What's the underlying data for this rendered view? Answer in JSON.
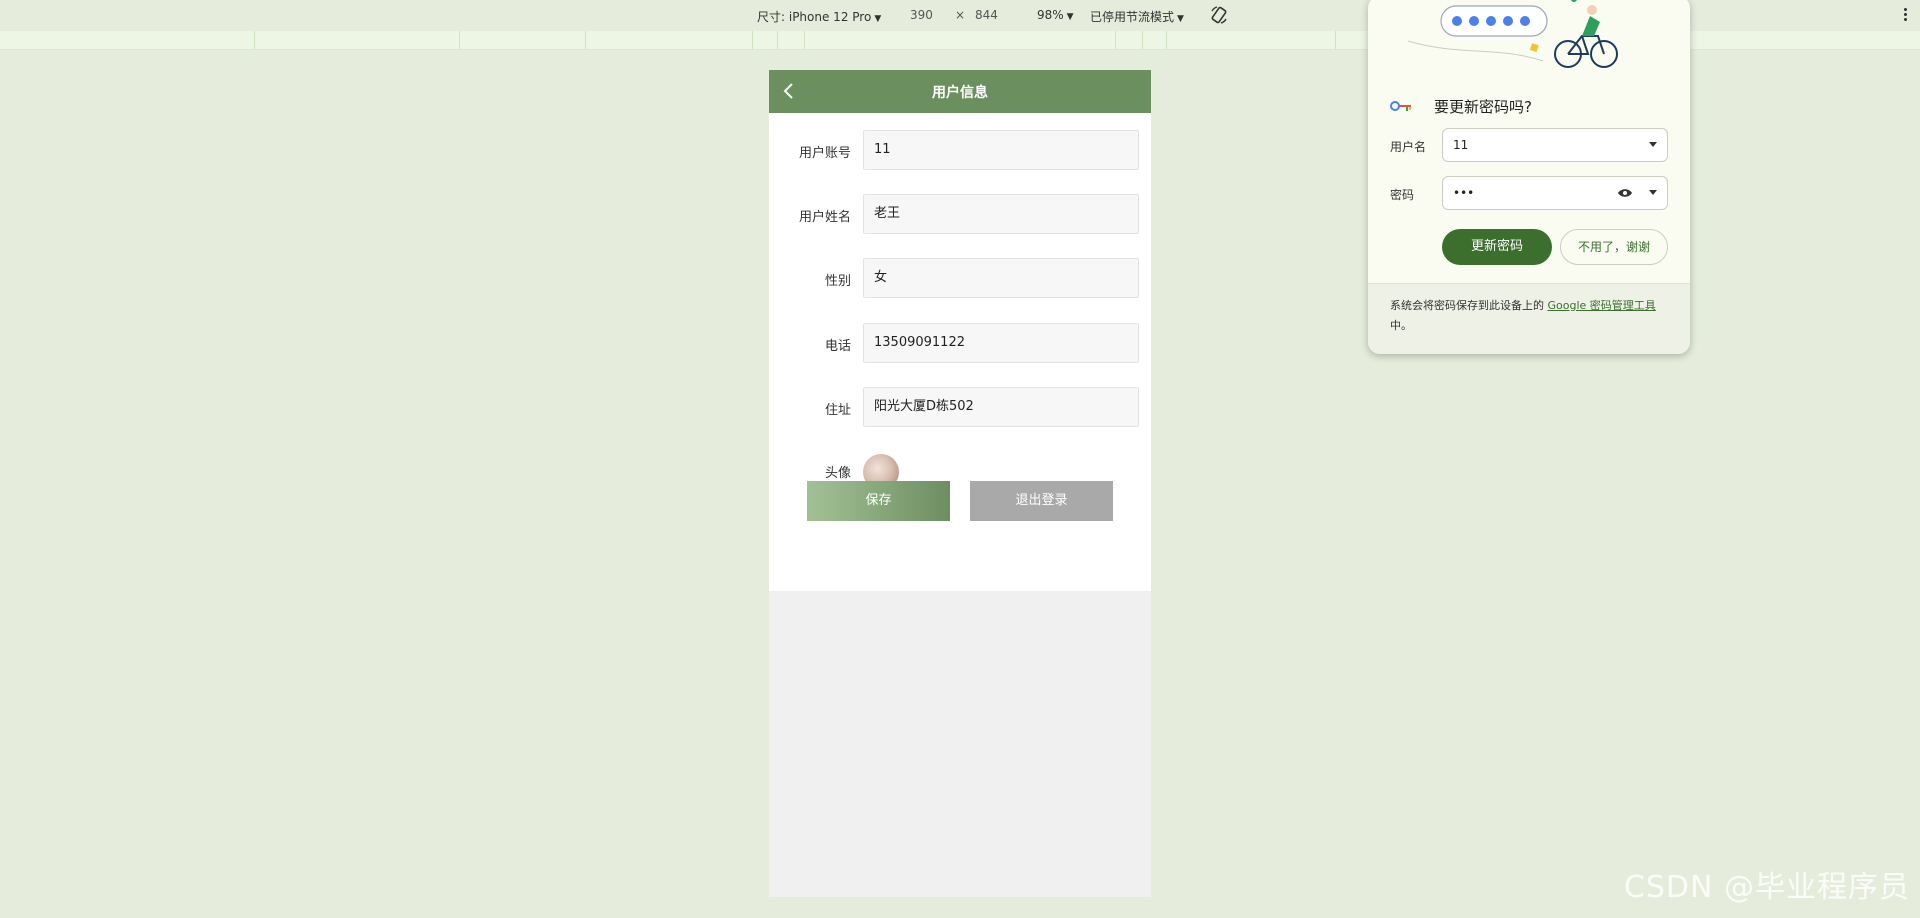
{
  "devtools": {
    "device_label": "尺寸: iPhone 12 Pro",
    "width": "390",
    "times": "×",
    "height": "844",
    "zoom": "98%",
    "throttle": "已停用节流模式"
  },
  "app": {
    "header_title": "用户信息",
    "fields": [
      {
        "label": "用户账号",
        "value": "11"
      },
      {
        "label": "用户姓名",
        "value": "老王"
      },
      {
        "label": "性别",
        "value": "女"
      },
      {
        "label": "电话",
        "value": "13509091122"
      },
      {
        "label": "住址",
        "value": "阳光大厦D栋502"
      }
    ],
    "avatar_label": "头像",
    "save_label": "保存",
    "logout_label": "退出登录"
  },
  "password_popup": {
    "title": "要更新密码吗?",
    "username_label": "用户名",
    "username_value": "11",
    "password_label": "密码",
    "password_value": "•••",
    "update_button": "更新密码",
    "no_thanks_button": "不用了，谢谢",
    "footer_text": "系统会将密码保存到此设备上的",
    "footer_link": "Google 密码管理工具",
    "footer_suffix": "中。"
  },
  "watermark": "CSDN @毕业程序员",
  "colors": {
    "page_bg": "#e5ecdb",
    "header_green": "#6b8f5f",
    "update_green": "#3c6e2e",
    "logout_gray": "#a9a9a9"
  }
}
